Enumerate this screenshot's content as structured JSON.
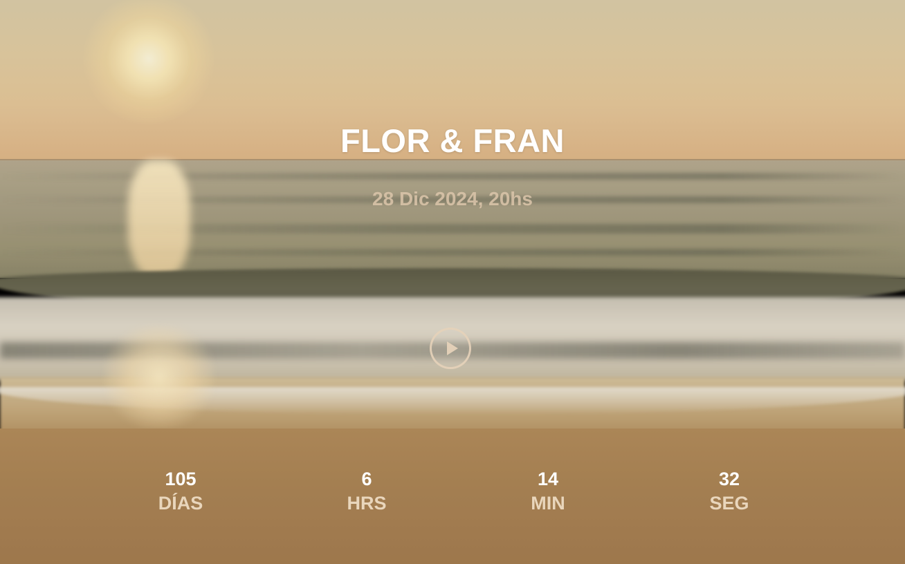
{
  "hero": {
    "title": "FLOR & FRAN",
    "date": "28 Dic 2024, 20hs"
  },
  "video": {
    "play_icon": "play-icon"
  },
  "countdown": [
    {
      "value": "105",
      "label": "DÍAS"
    },
    {
      "value": "6",
      "label": "HRS"
    },
    {
      "value": "14",
      "label": "MIN"
    },
    {
      "value": "32",
      "label": "SEG"
    }
  ],
  "colors": {
    "title": "#ffffff",
    "date": "#dcc6aa",
    "countdown_label": "#e9d6bc",
    "play_button": "#e6d2b9"
  }
}
